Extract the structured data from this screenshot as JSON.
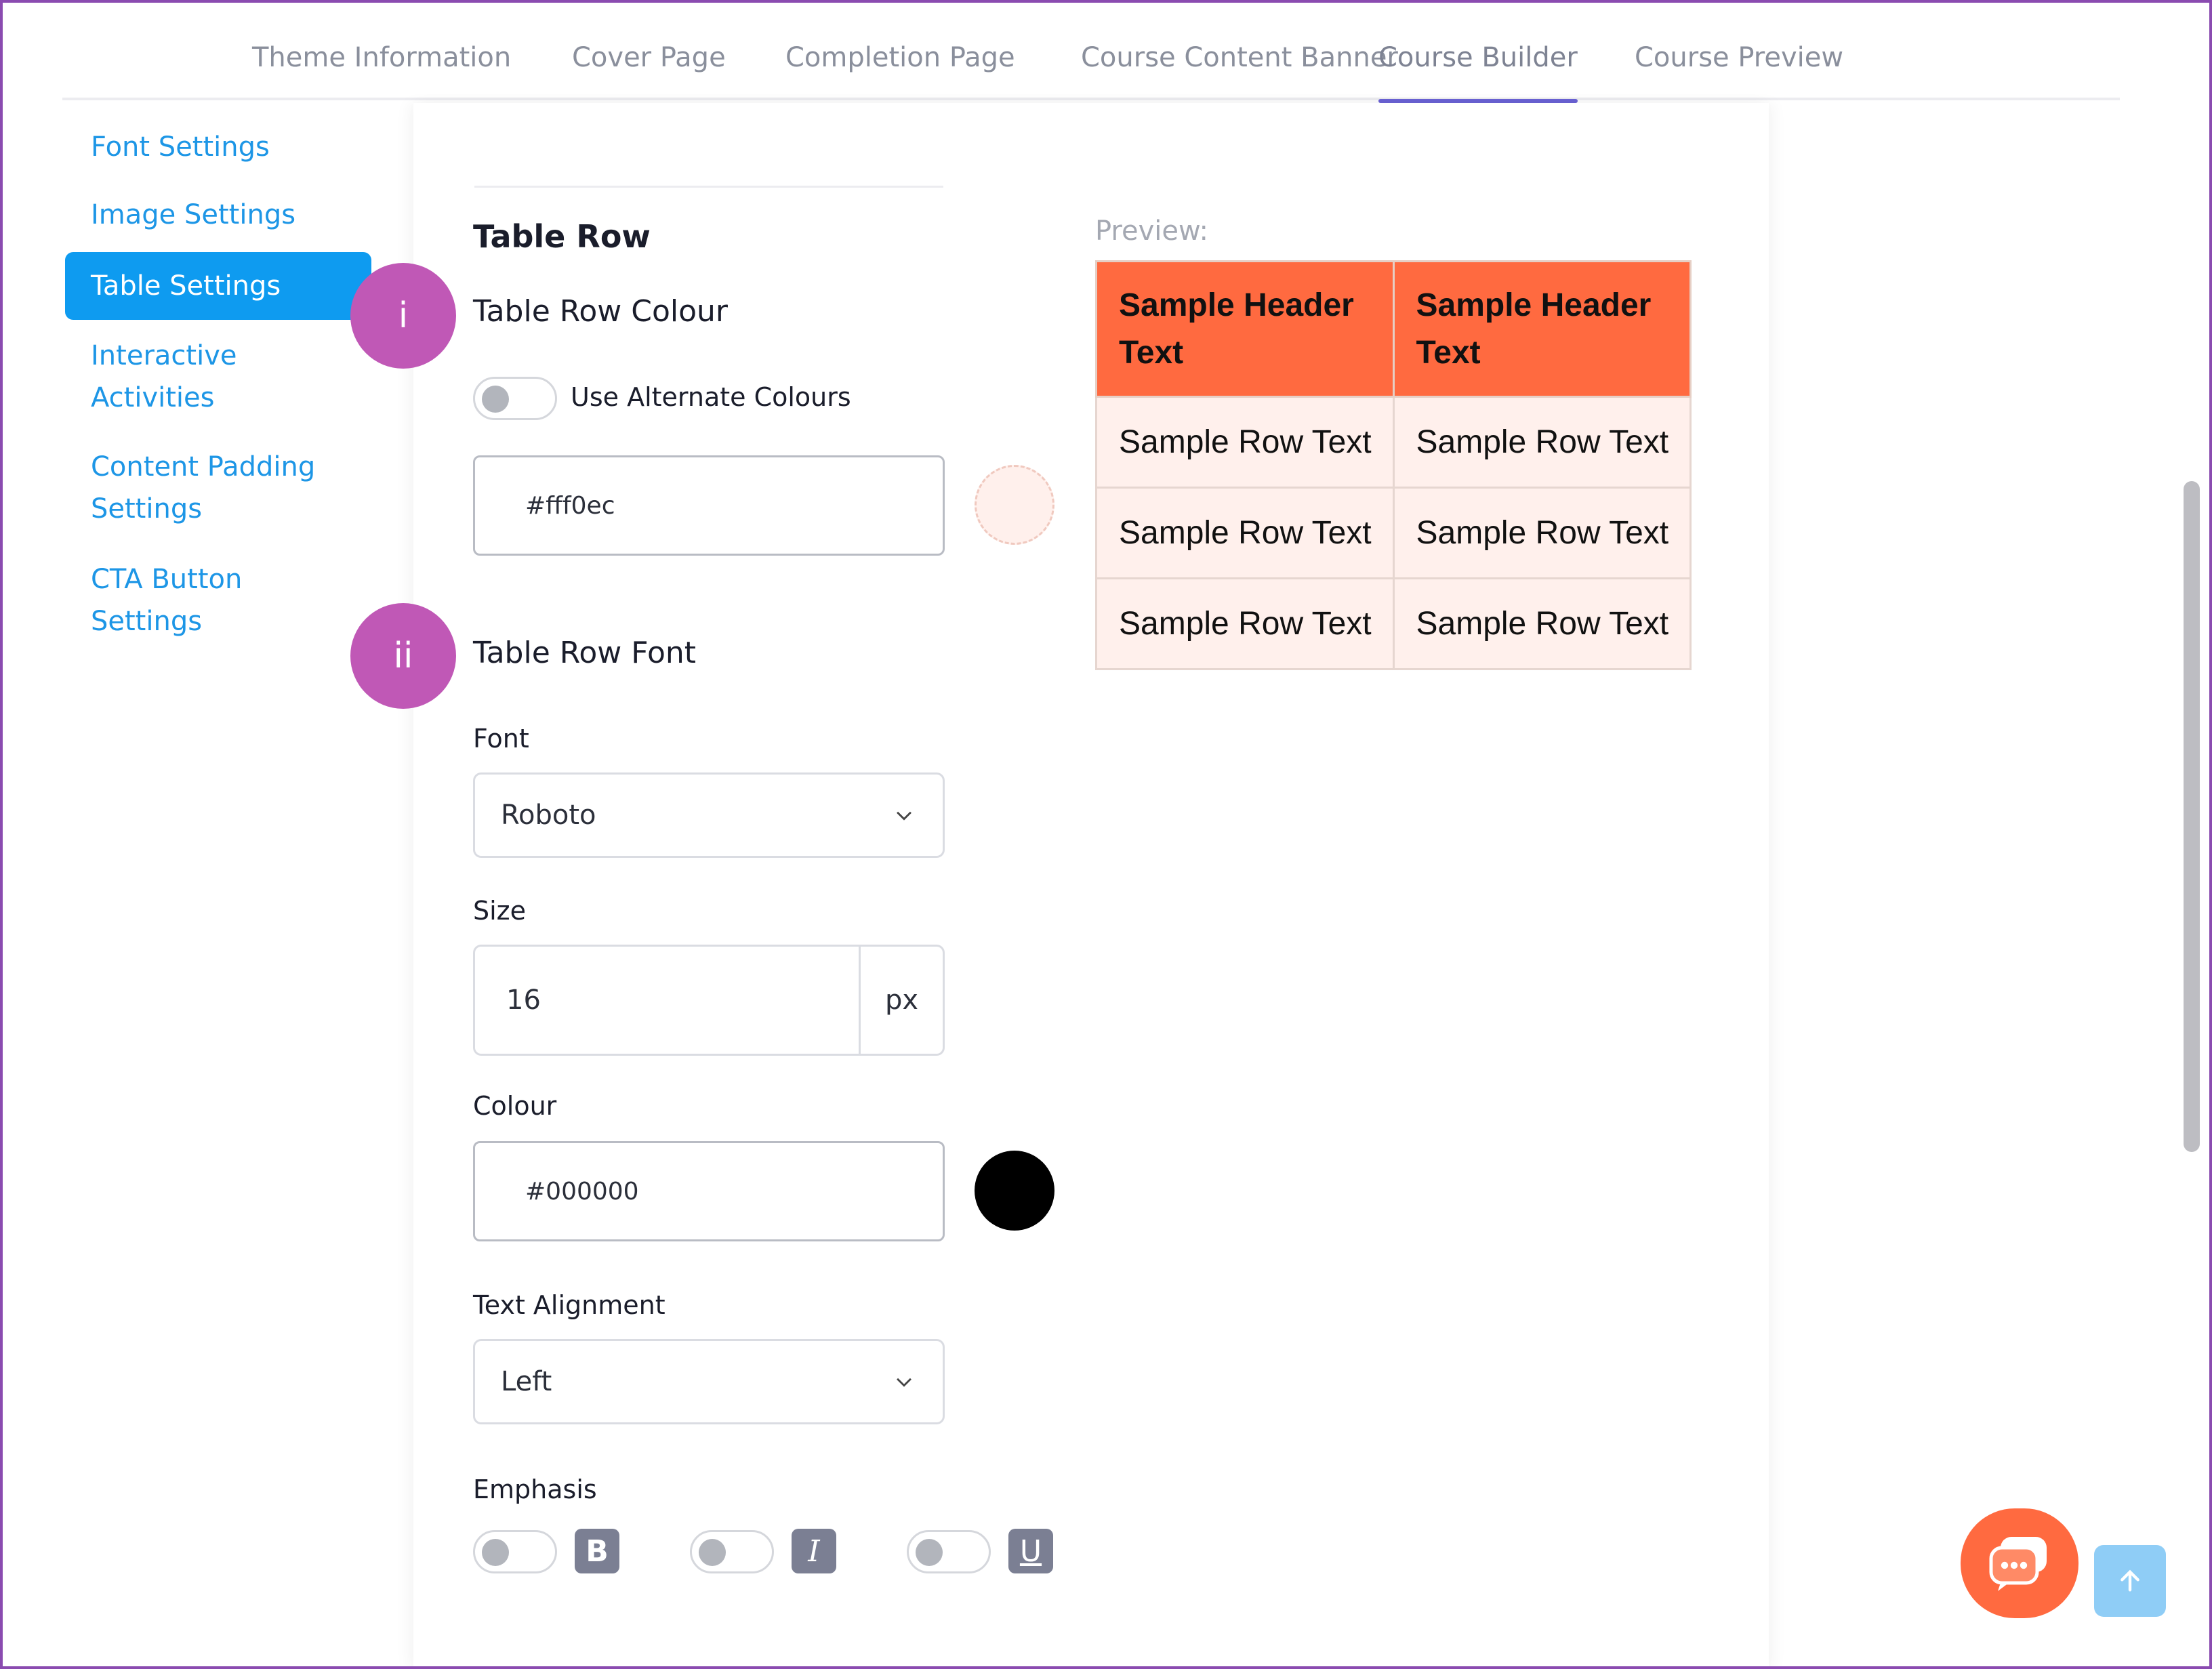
{
  "tabs": [
    {
      "label": "Theme Information"
    },
    {
      "label": "Cover Page"
    },
    {
      "label": "Completion Page"
    },
    {
      "label": "Course Content Banner"
    },
    {
      "label": "Course Builder",
      "active": true
    },
    {
      "label": "Course Preview"
    }
  ],
  "sidebar": {
    "items": [
      {
        "label": "Font Settings"
      },
      {
        "label": "Image Settings"
      },
      {
        "label": "Table Settings",
        "active": true
      },
      {
        "line1": "Interactive",
        "line2": "Activities"
      },
      {
        "line1": "Content Padding",
        "line2": "Settings"
      },
      {
        "line1": "CTA Button",
        "line2": "Settings"
      }
    ]
  },
  "badges": {
    "i": "i",
    "ii": "ii"
  },
  "section": {
    "title": "Table Row",
    "row_colour_heading": "Table Row Colour",
    "alternate_label": "Use Alternate Colours",
    "alternate_on": false,
    "row_colour_value": "#fff0ec",
    "row_font_heading": "Table Row Font",
    "font_label": "Font",
    "font_value": "Roboto",
    "size_label": "Size",
    "size_value": "16",
    "size_unit": "px",
    "colour_label": "Colour",
    "colour_value": "#000000",
    "alignment_label": "Text Alignment",
    "alignment_value": "Left",
    "emphasis_label": "Emphasis",
    "emphasis": [
      {
        "glyph": "B",
        "on": false
      },
      {
        "glyph": "I",
        "on": false
      },
      {
        "glyph": "U",
        "on": false
      }
    ]
  },
  "preview": {
    "label": "Preview:",
    "header": [
      {
        "line1": "Sample Header",
        "line2": "Text"
      },
      {
        "line1": "Sample Header",
        "line2": "Text"
      }
    ],
    "rows": [
      [
        "Sample Row Text",
        "Sample Row Text"
      ],
      [
        "Sample Row Text",
        "Sample Row Text"
      ],
      [
        "Sample Row Text",
        "Sample Row Text"
      ]
    ],
    "header_bg": "#ff6a40",
    "row_bg": "#fff0ec"
  },
  "colors": {
    "accent": "#0e9bf0",
    "tab_underline": "#6b63d6",
    "badge": "#c058b6",
    "chat": "#ff6a40"
  },
  "icons": {
    "select_chevron": "chevron-down-icon",
    "chat": "chat-bubble-icon",
    "scroll_top": "arrow-up-icon"
  }
}
